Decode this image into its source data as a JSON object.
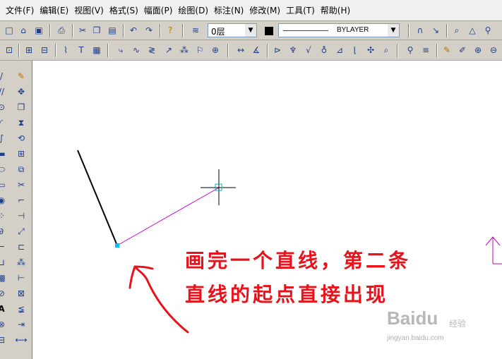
{
  "menubar": {
    "items": [
      "文件(F)",
      "编辑(E)",
      "视图(V)",
      "格式(S)",
      "幅面(P)",
      "绘图(D)",
      "标注(N)",
      "修改(M)",
      "工具(T)",
      "帮助(H)"
    ]
  },
  "properties": {
    "layer": "0层",
    "linetype": "BYLAYER",
    "color": "#000000",
    "line_color": "#e00000"
  },
  "toolbar_icons": {
    "row1": [
      "new-file-icon",
      "open-file-icon",
      "save-icon",
      "print-icon",
      "cut-icon",
      "copy-icon",
      "paste-icon",
      "undo-icon",
      "redo-icon",
      "help-icon",
      "layer-manager-icon"
    ],
    "row1_right": [
      "snap-icon",
      "pan-icon",
      "zoom-icon",
      "zoom-window-icon",
      "zoom-extents-icon",
      "regen-icon"
    ],
    "row2": [
      "window-select-icon",
      "zoom-all-icon",
      "zoom-previous-icon",
      "text-icon",
      "block-icon",
      "polyline-icon",
      "spline-icon",
      "wave-icon",
      "arrow-icon",
      "hatch-icon",
      "section-icon",
      "cross-icon",
      "dimension-icon",
      "angle-icon",
      "linear-dim-icon",
      "radius-dim-icon",
      "datum-icon",
      "tolerance-icon",
      "leader-icon",
      "weld-icon",
      "roughness-icon",
      "measure-icon",
      "edit-icon",
      "paint-icon",
      "query-icon"
    ]
  },
  "left_tools": [
    "line-tool-icon",
    "polyline-tool-icon",
    "circle-tool-icon",
    "arc-tool-icon",
    "spline-tool-icon",
    "rectangle-tool-icon",
    "ellipse-tool-icon",
    "polygon-tool-icon",
    "point-tool-icon",
    "hatch-tool-icon",
    "text-tool-icon",
    "block-tool-icon",
    "table-tool-icon",
    "image-tool-icon",
    "erase-tool-icon",
    "move-tool-icon",
    "copy-tool-icon",
    "mirror-tool-icon",
    "rotate-tool-icon",
    "array-tool-icon",
    "scale-tool-icon",
    "trim-tool-icon",
    "fillet-tool-icon",
    "extend-tool-icon",
    "break-tool-icon",
    "stretch-tool-icon",
    "explode-tool-icon",
    "edit-tool-icon"
  ],
  "annotation": {
    "line1": "画完一个直线，第二条",
    "line2": "直线的起点直接出现",
    "color": "#e8131a"
  },
  "drawing": {
    "first_line_color": "#000000",
    "rubber_band_color": "#cc00cc",
    "snap_marker_color": "#00c0ff"
  },
  "watermark": {
    "logo": "Baidu",
    "tag": "经验",
    "url": "jingyan.baidu.com"
  }
}
